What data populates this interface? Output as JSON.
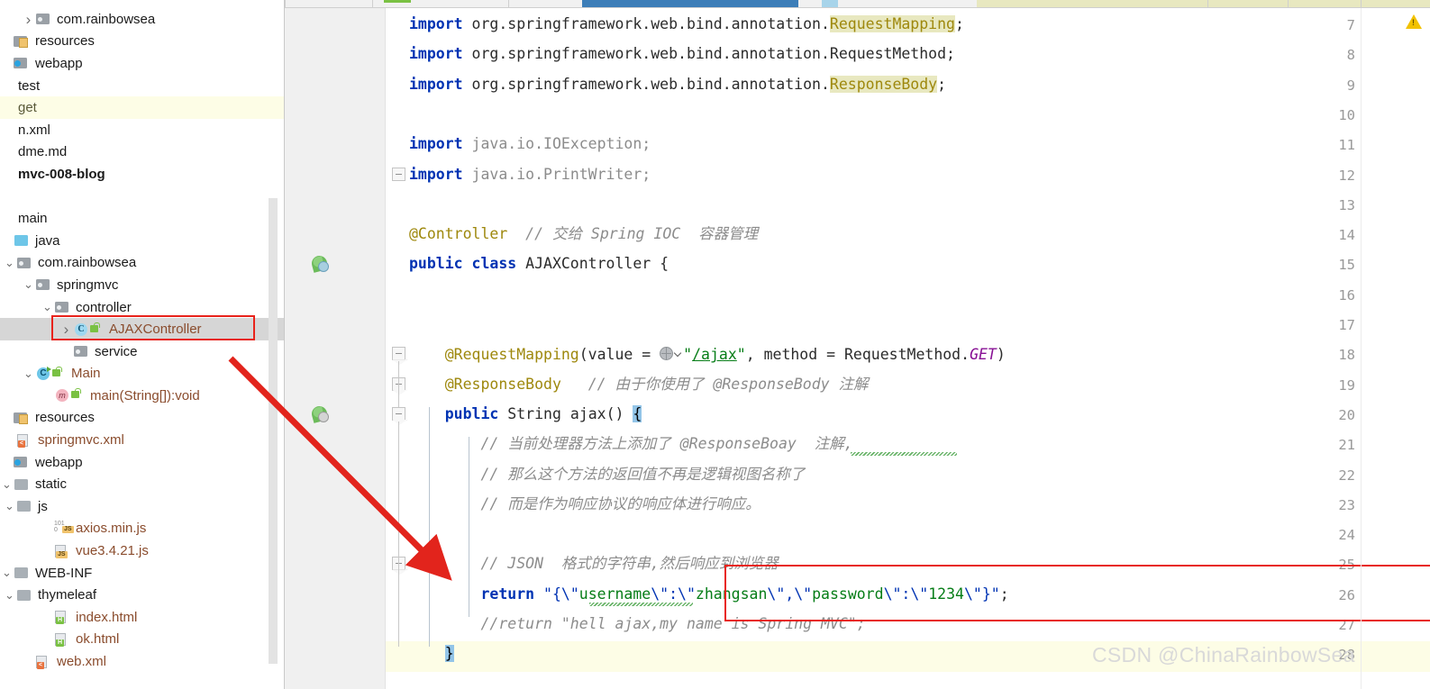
{
  "app": {
    "watermark": "CSDN @ChinaRainbowSea"
  },
  "sidebar": {
    "name": "project-tree",
    "scrollbar": true,
    "selected_row_label": "AJAXController",
    "items": [
      {
        "label": "com.rainbowsea",
        "indent": 2,
        "twisty": ">",
        "icon": "folder-gray",
        "style": "dark",
        "highlight": "none"
      },
      {
        "label": "resources",
        "indent": 0,
        "twisty": "",
        "icon": "folder-resources",
        "style": "dark",
        "highlight": "none"
      },
      {
        "label": "webapp",
        "indent": 0,
        "twisty": "",
        "icon": "folder-webapp",
        "style": "dark",
        "highlight": "none"
      },
      {
        "label": "test",
        "indent": 0,
        "twisty": "",
        "icon": "none",
        "style": "dark",
        "highlight": "none"
      },
      {
        "label": "get",
        "indent": 0,
        "twisty": "",
        "icon": "none",
        "style": "gray",
        "highlight": "ivory"
      },
      {
        "label": "n.xml",
        "indent": 0,
        "twisty": "",
        "icon": "none",
        "style": "dark",
        "highlight": "none"
      },
      {
        "label": "dme.md",
        "indent": 0,
        "twisty": "",
        "icon": "none",
        "style": "dark",
        "highlight": "none"
      },
      {
        "label": "mvc-008-blog",
        "indent": 0,
        "twisty": "",
        "icon": "none",
        "style": "bold",
        "highlight": "none"
      },
      {
        "label": "",
        "indent": 0,
        "twisty": "",
        "icon": "none",
        "style": "dark",
        "highlight": "none"
      },
      {
        "label": "main",
        "indent": 0,
        "twisty": "",
        "icon": "none",
        "style": "dark",
        "highlight": "none"
      },
      {
        "label": "java",
        "indent": 0,
        "twisty": "",
        "icon": "folder-blue",
        "style": "dark",
        "highlight": "none"
      },
      {
        "label": "com.rainbowsea",
        "indent": 1,
        "twisty": "v",
        "icon": "folder-gray",
        "style": "dark",
        "highlight": "none"
      },
      {
        "label": "springmvc",
        "indent": 2,
        "twisty": "v",
        "icon": "folder-gray",
        "style": "dark",
        "highlight": "none"
      },
      {
        "label": "controller",
        "indent": 3,
        "twisty": "v",
        "icon": "folder-gray",
        "style": "dark",
        "highlight": "none"
      },
      {
        "label": "AJAXController",
        "indent": 4,
        "twisty": ">",
        "icon": "class-lock",
        "style": "brown",
        "highlight": "selected"
      },
      {
        "label": "service",
        "indent": 4,
        "twisty": "",
        "icon": "folder-gray",
        "style": "dark",
        "highlight": "none"
      },
      {
        "label": "Main",
        "indent": 2,
        "twisty": "v",
        "icon": "class-run-lock",
        "style": "brown",
        "highlight": "none"
      },
      {
        "label": "main(String[]):void",
        "indent": 3,
        "twisty": "",
        "icon": "method-lock",
        "style": "brown",
        "highlight": "none"
      },
      {
        "label": "resources",
        "indent": 0,
        "twisty": "",
        "icon": "folder-resources",
        "style": "dark",
        "highlight": "none"
      },
      {
        "label": "springmvc.xml",
        "indent": 1,
        "twisty": "",
        "icon": "file-xml",
        "style": "brown",
        "highlight": "none"
      },
      {
        "label": "webapp",
        "indent": 0,
        "twisty": "",
        "icon": "folder-webapp",
        "style": "dark",
        "highlight": "none"
      },
      {
        "label": "static",
        "indent": 0,
        "twisty": "v",
        "icon": "folder-plain",
        "style": "dark",
        "highlight": "none"
      },
      {
        "label": "js",
        "indent": 1,
        "twisty": "v",
        "icon": "folder-plain",
        "style": "dark",
        "highlight": "none"
      },
      {
        "label": "axios.min.js",
        "indent": 3,
        "twisty": "",
        "icon": "file-js-101",
        "style": "brown",
        "highlight": "none"
      },
      {
        "label": "vue3.4.21.js",
        "indent": 3,
        "twisty": "",
        "icon": "file-js",
        "style": "brown",
        "highlight": "none"
      },
      {
        "label": "WEB-INF",
        "indent": 0,
        "twisty": "v",
        "icon": "folder-plain",
        "style": "dark",
        "highlight": "none"
      },
      {
        "label": "thymeleaf",
        "indent": 1,
        "twisty": "v",
        "icon": "folder-plain",
        "style": "dark",
        "highlight": "none"
      },
      {
        "label": "index.html",
        "indent": 3,
        "twisty": "",
        "icon": "file-html",
        "style": "brown",
        "highlight": "none"
      },
      {
        "label": "ok.html",
        "indent": 3,
        "twisty": "",
        "icon": "file-html",
        "style": "brown",
        "highlight": "none"
      },
      {
        "label": "web.xml",
        "indent": 2,
        "twisty": "",
        "icon": "file-xml",
        "style": "brown",
        "highlight": "none"
      }
    ]
  },
  "editor": {
    "name": "java-code-editor",
    "file": "AJAXController.java",
    "first_visible_line": 7,
    "gutter_icons": [
      {
        "line": 15,
        "icon": "spring-bean-icon"
      },
      {
        "line": 20,
        "icon": "spring-endpoint-icon"
      }
    ],
    "lines": [
      {
        "n": 7,
        "bg": "none",
        "tokens": [
          {
            "t": "import ",
            "c": "kw"
          },
          {
            "t": "org.springframework.web.bind.annotation.",
            "c": "plain"
          },
          {
            "t": "RequestMapping",
            "c": "annohl"
          },
          {
            "t": ";",
            "c": "plain"
          }
        ]
      },
      {
        "n": 8,
        "bg": "none",
        "tokens": [
          {
            "t": "import ",
            "c": "kw"
          },
          {
            "t": "org.springframework.web.bind.annotation.RequestMethod;",
            "c": "plain"
          }
        ]
      },
      {
        "n": 9,
        "bg": "none",
        "tokens": [
          {
            "t": "import ",
            "c": "kw"
          },
          {
            "t": "org.springframework.web.bind.annotation.",
            "c": "plain"
          },
          {
            "t": "ResponseBody",
            "c": "annohl"
          },
          {
            "t": ";",
            "c": "plain"
          }
        ]
      },
      {
        "n": 10,
        "bg": "none",
        "tokens": []
      },
      {
        "n": 11,
        "bg": "none",
        "tokens": [
          {
            "t": "import ",
            "c": "kw"
          },
          {
            "t": "java.io.IOException;",
            "c": "gray"
          }
        ]
      },
      {
        "n": 12,
        "bg": "none",
        "tokens": [
          {
            "t": "import ",
            "c": "kw"
          },
          {
            "t": "java.io.PrintWriter;",
            "c": "gray"
          }
        ]
      },
      {
        "n": 13,
        "bg": "none",
        "tokens": []
      },
      {
        "n": 14,
        "bg": "none",
        "tokens": [
          {
            "t": "@Controller",
            "c": "anno"
          },
          {
            "t": "  ",
            "c": "plain"
          },
          {
            "t": "// 交给 Spring IOC  容器管理",
            "c": "cmt"
          }
        ]
      },
      {
        "n": 15,
        "bg": "none",
        "tokens": [
          {
            "t": "public class ",
            "c": "kw"
          },
          {
            "t": "AJAXController ",
            "c": "plain"
          },
          {
            "t": "{",
            "c": "plain"
          }
        ]
      },
      {
        "n": 16,
        "bg": "none",
        "tokens": []
      },
      {
        "n": 17,
        "bg": "none",
        "tokens": []
      },
      {
        "n": 18,
        "bg": "none",
        "tokens": [
          {
            "t": "    @RequestMapping",
            "c": "anno"
          },
          {
            "t": "(value = ",
            "c": "plain"
          },
          {
            "t": "__GLOBE__",
            "c": "widget"
          },
          {
            "t": "\"",
            "c": "str"
          },
          {
            "t": "/ajax",
            "c": "url"
          },
          {
            "t": "\"",
            "c": "str"
          },
          {
            "t": ", method = RequestMethod.",
            "c": "plain"
          },
          {
            "t": "GET",
            "c": "lit"
          },
          {
            "t": ")",
            "c": "plain"
          }
        ]
      },
      {
        "n": 19,
        "bg": "none",
        "tokens": [
          {
            "t": "    @ResponseBody",
            "c": "anno"
          },
          {
            "t": "   ",
            "c": "plain"
          },
          {
            "t": "// 由于你使用了 @ResponseBody 注解",
            "c": "cmt"
          }
        ]
      },
      {
        "n": 20,
        "bg": "none",
        "tokens": [
          {
            "t": "    ",
            "c": "plain"
          },
          {
            "t": "public ",
            "c": "kw"
          },
          {
            "t": "String ",
            "c": "plain"
          },
          {
            "t": "ajax",
            "c": "plain"
          },
          {
            "t": "() ",
            "c": "plain"
          },
          {
            "t": "{",
            "c": "brace-hl"
          }
        ]
      },
      {
        "n": 21,
        "bg": "none",
        "tokens": [
          {
            "t": "        // 当前处理器方法上添加了 @ResponseBoay  注解,",
            "c": "cmt"
          }
        ]
      },
      {
        "n": 22,
        "bg": "none",
        "tokens": [
          {
            "t": "        // 那么这个方法的返回值不再是逻辑视图名称了",
            "c": "cmt"
          }
        ]
      },
      {
        "n": 23,
        "bg": "none",
        "tokens": [
          {
            "t": "        // 而是作为响应协议的响应体进行响应。",
            "c": "cmt"
          }
        ]
      },
      {
        "n": 24,
        "bg": "none",
        "tokens": []
      },
      {
        "n": 25,
        "bg": "none",
        "tokens": [
          {
            "t": "        // JSON  格式的字符串,然后响应到浏览器",
            "c": "cmt"
          }
        ]
      },
      {
        "n": 26,
        "bg": "none",
        "tokens": [
          {
            "t": "        return ",
            "c": "kw"
          },
          {
            "t": "\"{\\\"",
            "c": "strq"
          },
          {
            "t": "username",
            "c": "str"
          },
          {
            "t": "\\\":\\\"",
            "c": "strq"
          },
          {
            "t": "zhangsan",
            "c": "str"
          },
          {
            "t": "\\\",\\\"",
            "c": "strq"
          },
          {
            "t": "password",
            "c": "str"
          },
          {
            "t": "\\\":\\\"",
            "c": "strq"
          },
          {
            "t": "1234",
            "c": "str"
          },
          {
            "t": "\\\"}\"",
            "c": "strq"
          },
          {
            "t": ";",
            "c": "plain"
          }
        ]
      },
      {
        "n": 27,
        "bg": "none",
        "tokens": [
          {
            "t": "        //return \"hell ajax,my name is Spring MVC\";",
            "c": "cmt"
          }
        ]
      },
      {
        "n": 28,
        "bg": "ivory",
        "tokens": [
          {
            "t": "    ",
            "c": "plain"
          },
          {
            "t": "}",
            "c": "brace-hl"
          }
        ]
      }
    ]
  },
  "annotations": {
    "sidebar_highlight_box": {
      "color": "#e8231b",
      "target": "AJAXController"
    },
    "code_highlight_box": {
      "color": "#e8231b",
      "target_lines": "25-26"
    },
    "arrow": {
      "color": "#e2241c",
      "from": "AJAXController",
      "to": "return-statement"
    }
  },
  "icons": {
    "warning": "warning-triangle-icon"
  },
  "colors": {
    "accent_red": "#e8231b",
    "selection_gray": "#d6d6d6",
    "highlight_ivory": "#fdfde6",
    "keyword_blue": "#0033b3",
    "string_green": "#067d17",
    "annotation_olive": "#9e880d",
    "comment_gray": "#8c8c8c"
  }
}
